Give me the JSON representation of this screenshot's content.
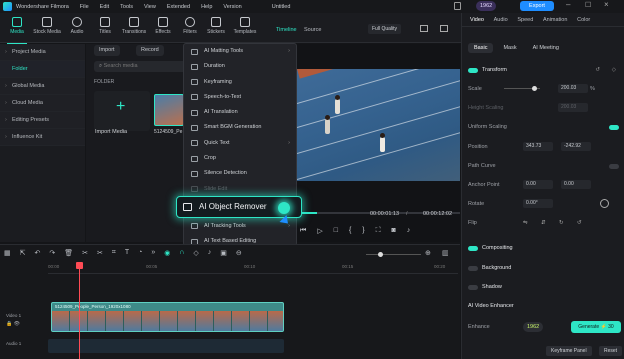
{
  "titlebar": {
    "app_name": "Wondershare Filmora",
    "menu": [
      "File",
      "Edit",
      "Tools",
      "View",
      "Extended",
      "Help",
      "Version"
    ],
    "project": "Untitled",
    "credits": "1962",
    "export_label": "Export"
  },
  "toolbar": {
    "tools": [
      {
        "label": "Media",
        "icon": "media-icon"
      },
      {
        "label": "Stock Media",
        "icon": "stock-media-icon"
      },
      {
        "label": "Audio",
        "icon": "audio-icon"
      },
      {
        "label": "Titles",
        "icon": "titles-icon"
      },
      {
        "label": "Transitions",
        "icon": "transitions-icon"
      },
      {
        "label": "Effects",
        "icon": "effects-icon"
      },
      {
        "label": "Filters",
        "icon": "filters-icon"
      },
      {
        "label": "Stickers",
        "icon": "stickers-icon"
      },
      {
        "label": "Templates",
        "icon": "templates-icon"
      }
    ],
    "player_tabs": [
      "Timeline",
      "Source"
    ],
    "quality": "Full Quality"
  },
  "sidebar": {
    "items": [
      {
        "label": "Project Media",
        "type": "head"
      },
      {
        "label": "Folder",
        "type": "sel"
      },
      {
        "label": "Global Media",
        "type": "item"
      },
      {
        "label": "Cloud Media",
        "type": "item"
      },
      {
        "label": "Editing Presets",
        "type": "item"
      },
      {
        "label": "Influence Kit",
        "type": "item"
      }
    ]
  },
  "media": {
    "import_label": "Import",
    "record_label": "Record",
    "search_placeholder": "Search media",
    "folder_header": "FOLDER",
    "import_media_label": "Import Media",
    "clip_name": "5124509_Pe"
  },
  "dropdown": {
    "items": [
      {
        "label": "AI Matting Tools",
        "arrow": true,
        "dim": false
      },
      {
        "label": "Duration",
        "arrow": false,
        "dim": false
      },
      {
        "label": "Keyframing",
        "arrow": false,
        "dim": false
      },
      {
        "label": "Speech-to-Text",
        "arrow": false,
        "dim": false
      },
      {
        "label": "AI Translation",
        "arrow": false,
        "dim": false
      },
      {
        "label": "Smart BGM Generation",
        "arrow": false,
        "dim": false
      },
      {
        "label": "Quick Text",
        "arrow": true,
        "dim": false
      },
      {
        "label": "Crop",
        "arrow": false,
        "dim": false
      },
      {
        "label": "Silence Detection",
        "arrow": false,
        "dim": false
      },
      {
        "label": "Slide Edit",
        "arrow": false,
        "dim": true
      }
    ],
    "highlight": "AI Object Remover",
    "after": [
      {
        "label": "AI Tracking Tools",
        "arrow": true
      },
      {
        "label": "AI Text Based Editing",
        "arrow": false
      }
    ]
  },
  "player": {
    "current_time": "00:00:01:13",
    "total_time": "00:00:12:02",
    "progress": 0.12
  },
  "right_panel": {
    "tabs": [
      "Video",
      "Audio",
      "Speed",
      "Animation",
      "Color"
    ],
    "subtabs": [
      "Basic",
      "Mask",
      "AI Meeting"
    ],
    "transform_label": "Transform",
    "scale_label": "Scale",
    "scale_value": "200.03",
    "height_scaling_label": "Height Scaling",
    "height_scaling_value": "200.03",
    "uniform_label": "Uniform Scaling",
    "position_label": "Position",
    "pos_x": "343.73",
    "pos_y": "-242.92",
    "path_curve_label": "Path Curve",
    "anchor_label": "Anchor Point",
    "anchor_x": "0.00",
    "anchor_y": "0.00",
    "rotate_label": "Rotate",
    "rotate_value": "0.00°",
    "flip_label": "Flip",
    "compositing_label": "Compositing",
    "background_label": "Background",
    "shadow_label": "Shadow",
    "enhancer_label": "AI Video Enhancer",
    "enhance_label": "Enhance",
    "enhance_credits": "1962",
    "generate_label": "Generate",
    "generate_cost": "30",
    "keyframe_panel_label": "Keyframe Panel",
    "reset_label": "Reset"
  },
  "timeline": {
    "ruler": [
      "00:00",
      "00:05",
      "00:10",
      "00:15",
      "00:20",
      "00:25",
      "00:30"
    ],
    "video_track": "Video 1",
    "audio_track": "Audio 1",
    "clip_label": "5124509_People_Person_1920x1080"
  },
  "colors": {
    "accent": "#2ee6c6",
    "export": "#1e8dff"
  }
}
